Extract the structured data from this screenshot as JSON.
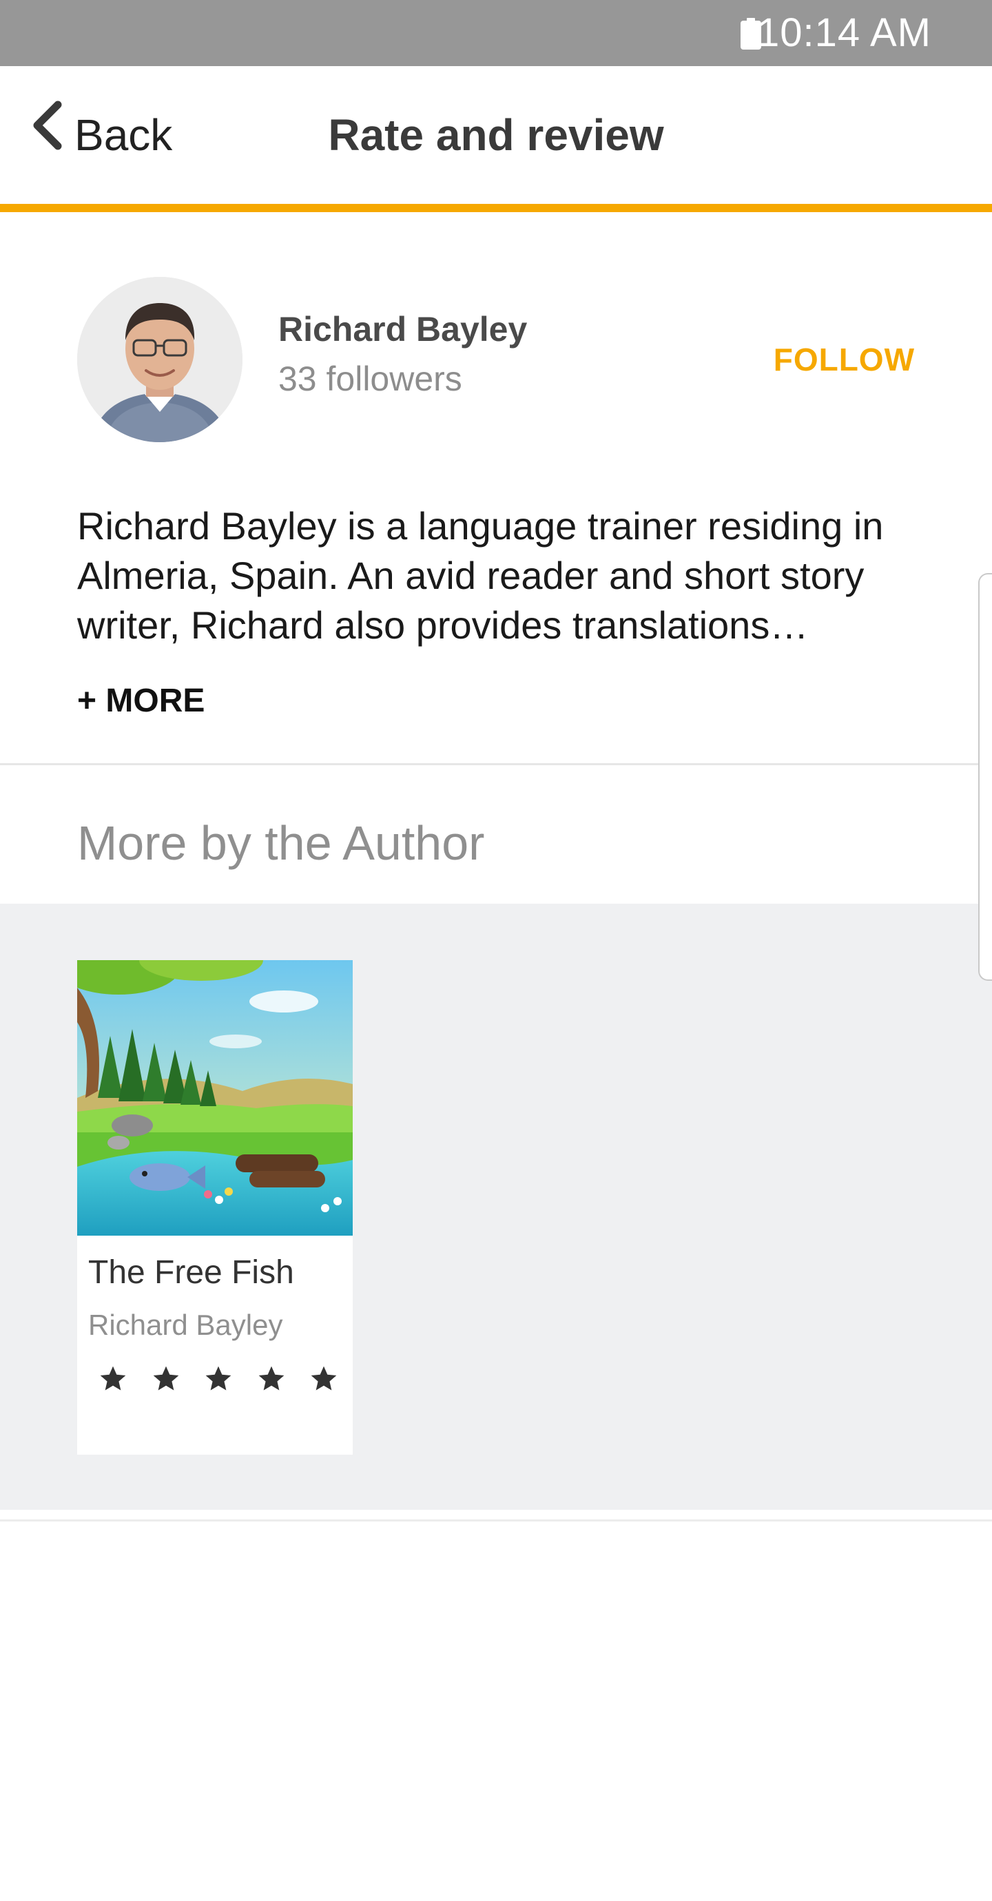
{
  "status_bar": {
    "time": "10:14 AM",
    "battery_icon": "battery-icon"
  },
  "header": {
    "back_label": "Back",
    "back_icon": "chevron-left-icon",
    "title": "Rate and review",
    "accent_color": "#f6a800"
  },
  "author": {
    "name": "Richard Bayley",
    "followers": "33 followers",
    "follow_label": "FOLLOW",
    "bio": "Richard Bayley is a language trainer residing in Almeria, Spain. An avid reader and short story writer, Richard also provides translations…",
    "more_label": "+ MORE"
  },
  "more_by_author": {
    "title": "More by the Author",
    "books": [
      {
        "title": "The Free Fish",
        "author": "Richard Bayley",
        "rating": 5
      }
    ]
  }
}
